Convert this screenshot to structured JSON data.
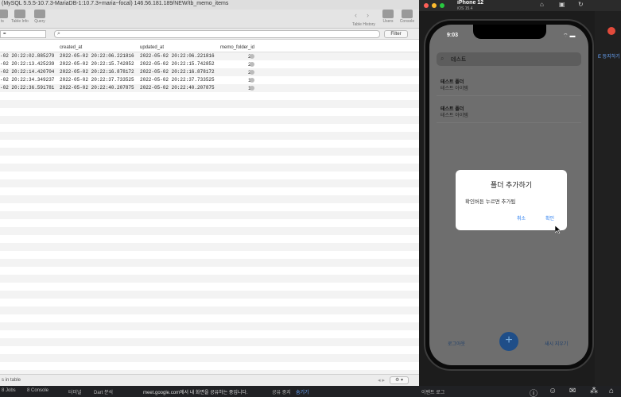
{
  "sequel": {
    "title": "(MySQL 5.5.5-10.7.3-MariaDB-1:10.7.3+maria~focal) 146.56.181.189/NEW/tb_memo_items",
    "toolbar": {
      "ts": "ts",
      "table_info": "Table Info",
      "query": "Query",
      "table_history": "Table History",
      "users": "Users",
      "console": "Console"
    },
    "filter": {
      "select_value": "=",
      "button": "Filter"
    },
    "columns": [
      "created_at",
      "updated_at",
      "memo_folder_id"
    ],
    "rows": [
      {
        "c1": "-02 20:22:02.885279",
        "c2": "2022-05-02 20:22:06.221816",
        "c3": "2022-05-02 20:22:06.221816",
        "c4": "2"
      },
      {
        "c1": "-02 20:22:13.425239",
        "c2": "2022-05-02 20:22:15.742852",
        "c3": "2022-05-02 20:22:15.742852",
        "c4": "2"
      },
      {
        "c1": "-02 20:22:14.420704",
        "c2": "2022-05-02 20:22:16.878172",
        "c3": "2022-05-02 20:22:16.878172",
        "c4": "2"
      },
      {
        "c1": "-02 20:22:34.349237",
        "c2": "2022-05-02 20:22:37.733525",
        "c3": "2022-05-02 20:22:37.733525",
        "c4": "1"
      },
      {
        "c1": "-02 20:22:36.591781",
        "c2": "2022-05-02 20:22:40.207875",
        "c3": "2022-05-02 20:22:40.207875",
        "c4": "1"
      }
    ],
    "status": "s in table"
  },
  "simulator": {
    "device": "iPhone 12",
    "os": "iOS 15.4",
    "time": "9:03",
    "search_value": "테스트",
    "folders": [
      {
        "title": "테스트 폴더",
        "subtitle": "테스트 아이템"
      },
      {
        "title": "테스트 폴더",
        "subtitle": "테스트 아이템"
      }
    ],
    "dialog": {
      "title": "폴더 추가하기",
      "message": "확인버튼 누르면 추가됨",
      "cancel": "취소",
      "ok": "확인"
    },
    "bottom": {
      "logout": "로그아웃",
      "fab": "+",
      "delete_all": "새시 지우기"
    }
  },
  "edge_panel": {
    "label": "E 등지하기"
  },
  "taskbar": {
    "items": [
      "8 Jobs",
      "8 Console",
      "터미널",
      "Dart 분석",
      "meet.google.com에서 내 화면을 공유하는 중입니다.",
      "공유 중지",
      "숨기기",
      "이벤트 로그"
    ]
  },
  "colors": {
    "accent": "#2a7ef0",
    "fab": "#1f4e88"
  }
}
